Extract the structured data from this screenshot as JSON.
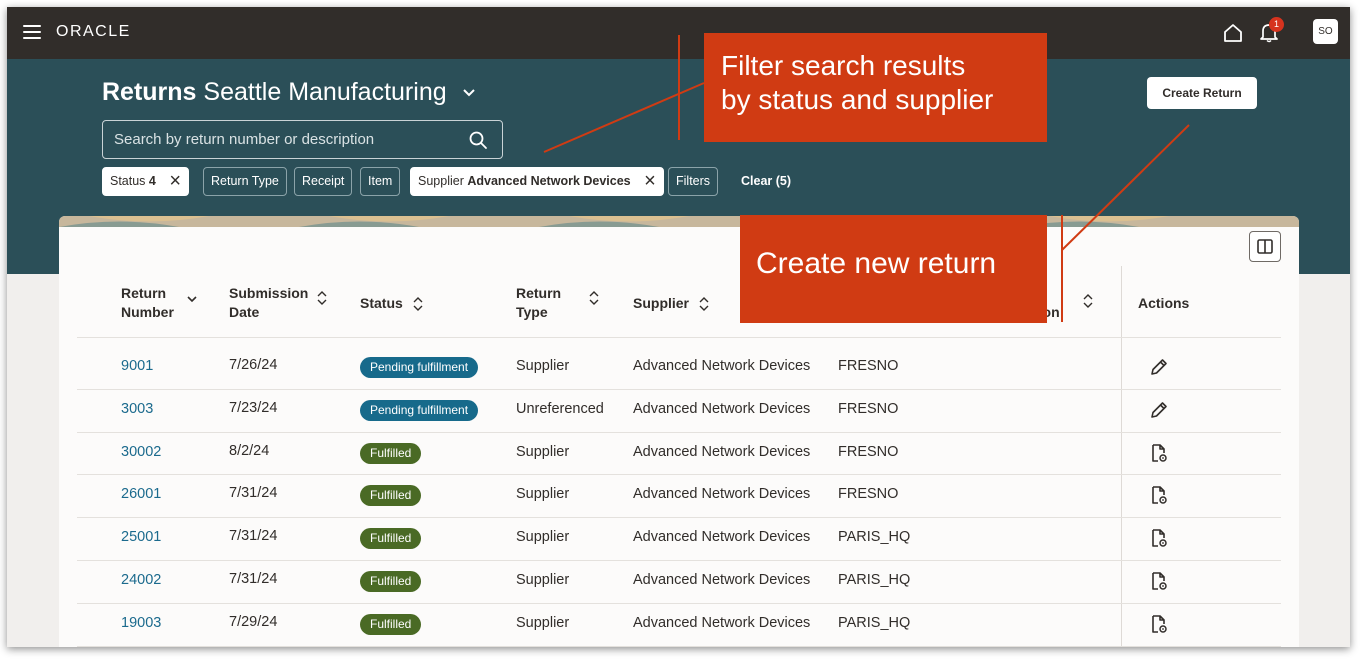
{
  "app": {
    "logo": "ORACLE",
    "notification_count": "1",
    "user_initials": "SO"
  },
  "header": {
    "title_bold": "Returns",
    "title_rest": "Seattle Manufacturing",
    "search_placeholder": "Search by return number or description",
    "create_button": "Create Return"
  },
  "filters": {
    "status": {
      "label": "Status",
      "value": "4"
    },
    "return_type": "Return Type",
    "receipt": "Receipt",
    "item": "Item",
    "supplier": {
      "label": "Supplier",
      "value": "Advanced Network Devices"
    },
    "filters": "Filters",
    "clear": "Clear (5)"
  },
  "callouts": {
    "filter_line1": "Filter search results",
    "filter_line2": "by status and supplier",
    "create": "Create new return"
  },
  "table": {
    "headers": {
      "return_number_1": "Return",
      "return_number_2": "Number",
      "submission_1": "Submission",
      "submission_2": "Date",
      "status": "Status",
      "return_type_1": "Return",
      "return_type_2": "Type",
      "supplier": "Supplier",
      "location_fragment": "tion",
      "actions": "Actions"
    },
    "rows": [
      {
        "number": "9001",
        "date": "7/26/24",
        "status": "Pending fulfillment",
        "kind": "pending",
        "type": "Supplier",
        "supplier": "Advanced Network Devices",
        "location": "FRESNO",
        "action": "edit-icon"
      },
      {
        "number": "3003",
        "date": "7/23/24",
        "status": "Pending fulfillment",
        "kind": "pending",
        "type": "Unreferenced",
        "supplier": "Advanced Network Devices",
        "location": "FRESNO",
        "action": "edit-icon"
      },
      {
        "number": "30002",
        "date": "8/2/24",
        "status": "Fulfilled",
        "kind": "fulfilled",
        "type": "Supplier",
        "supplier": "Advanced Network Devices",
        "location": "FRESNO",
        "action": "view-document-icon"
      },
      {
        "number": "26001",
        "date": "7/31/24",
        "status": "Fulfilled",
        "kind": "fulfilled",
        "type": "Supplier",
        "supplier": "Advanced Network Devices",
        "location": "FRESNO",
        "action": "view-document-icon"
      },
      {
        "number": "25001",
        "date": "7/31/24",
        "status": "Fulfilled",
        "kind": "fulfilled",
        "type": "Supplier",
        "supplier": "Advanced Network Devices",
        "location": "PARIS_HQ",
        "action": "view-document-icon"
      },
      {
        "number": "24002",
        "date": "7/31/24",
        "status": "Fulfilled",
        "kind": "fulfilled",
        "type": "Supplier",
        "supplier": "Advanced Network Devices",
        "location": "PARIS_HQ",
        "action": "view-document-icon"
      },
      {
        "number": "19003",
        "date": "7/29/24",
        "status": "Fulfilled",
        "kind": "fulfilled",
        "type": "Supplier",
        "supplier": "Advanced Network Devices",
        "location": "PARIS_HQ",
        "action": "view-document-icon"
      }
    ]
  },
  "colors": {
    "topbar": "#312d2a",
    "header": "#2b4f58",
    "callout": "#d03b13",
    "pending_badge": "#176a8b",
    "fulfilled_badge": "#4a6a25",
    "link": "#1b6a8d"
  }
}
